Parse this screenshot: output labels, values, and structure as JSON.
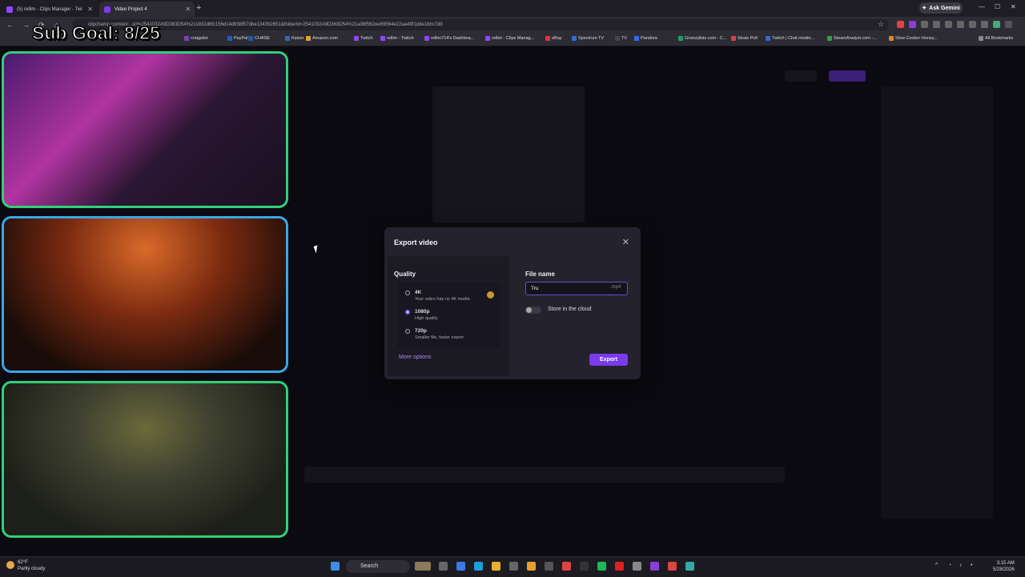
{
  "browser": {
    "tabs": [
      {
        "label": "(5) rellim - Clips Manager - Twi",
        "icon_color": "#9146ff"
      },
      {
        "label": "Video Project 4",
        "icon_color": "#7c3aed"
      }
    ],
    "new_tab": "+",
    "ask_gemini": "Ask Gemini",
    "url": "clipchamp.com/en/...sId=2541032A9D363D54%21s932d6fc156d14d938f57dbe134392651&folderId=2541032A9D363D54%21a06f562ee69564e22aa49f1dde1bbc7d8",
    "bookmarks": [
      {
        "label": "craigslist",
        "color": "#7b3fbf"
      },
      {
        "label": "PayPal",
        "color": "#1e5fc8"
      },
      {
        "label": "CHASE",
        "color": "#1c5ca8"
      },
      {
        "label": "Kaiser",
        "color": "#2b6ab8"
      },
      {
        "label": "Amazon.com",
        "color": "#e8a030"
      },
      {
        "label": "Twitch",
        "color": "#9146ff"
      },
      {
        "label": "rellim - Twitch",
        "color": "#9146ff"
      },
      {
        "label": "rellim714's Dashboa...",
        "color": "#9146ff"
      },
      {
        "label": "rellim - Clips Manag...",
        "color": "#9146ff"
      },
      {
        "label": "eBay",
        "color": "#e53238"
      },
      {
        "label": "Spectrum TV",
        "color": "#2f6cd6"
      },
      {
        "label": "TV",
        "color": "#444"
      },
      {
        "label": "Pandora",
        "color": "#3668ff"
      },
      {
        "label": "Groovylists.com - C...",
        "color": "#20a060"
      },
      {
        "label": "Straw Poll",
        "color": "#d84040"
      },
      {
        "label": "Twitch | Chat moder...",
        "color": "#2f6cd6"
      },
      {
        "label": "SteamAnalyst.com -...",
        "color": "#3aa03a"
      },
      {
        "label": "Slow Cooker Honey...",
        "color": "#d88a2a"
      },
      {
        "label": "All Bookmarks",
        "color": "#888"
      }
    ]
  },
  "overlay": {
    "sub_goal": "Sub Goal: 8/25"
  },
  "export_dialog": {
    "title": "Export video",
    "close": "✕",
    "quality_label": "Quality",
    "options": [
      {
        "title": "4K",
        "subtitle": "Your video has no 4K media",
        "selected": false
      },
      {
        "title": "1080p",
        "subtitle": "High quality",
        "selected": true
      },
      {
        "title": "720p",
        "subtitle": "Smaller file, faster export",
        "selected": false
      }
    ],
    "more_options": "More options",
    "file_name_label": "File name",
    "file_name_value": "Tru",
    "file_ext": ".mp4",
    "store_cloud_label": "Store in the cloud",
    "store_cloud_on": false,
    "export_button": "Export"
  },
  "taskbar": {
    "weather_temp": "62°F",
    "weather_desc": "Partly cloudy",
    "search_placeholder": "Search",
    "time": "3:15 AM",
    "date": "5/28/2026"
  }
}
